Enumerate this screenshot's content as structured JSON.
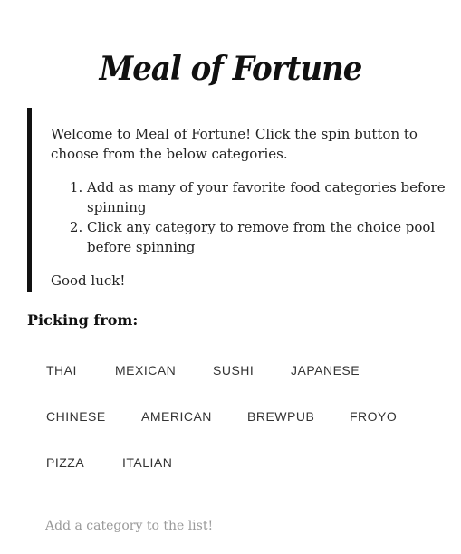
{
  "app": {
    "title": "Meal of Fortune"
  },
  "intro": {
    "welcome": "Welcome to Meal of Fortune! Click the spin button to choose from the below categories.",
    "steps": [
      "Add as many of your favorite food categories before spinning",
      "Click any category to remove from the choice pool before spinning"
    ],
    "closing": "Good luck!"
  },
  "picking": {
    "heading": "Picking from:",
    "categories": [
      "THAI",
      "MEXICAN",
      "SUSHI",
      "JAPANESE",
      "CHINESE",
      "AMERICAN",
      "BREWPUB",
      "FROYO",
      "PIZZA",
      "ITALIAN"
    ]
  },
  "add_category": {
    "placeholder": "Add a category to the list!",
    "value": ""
  }
}
